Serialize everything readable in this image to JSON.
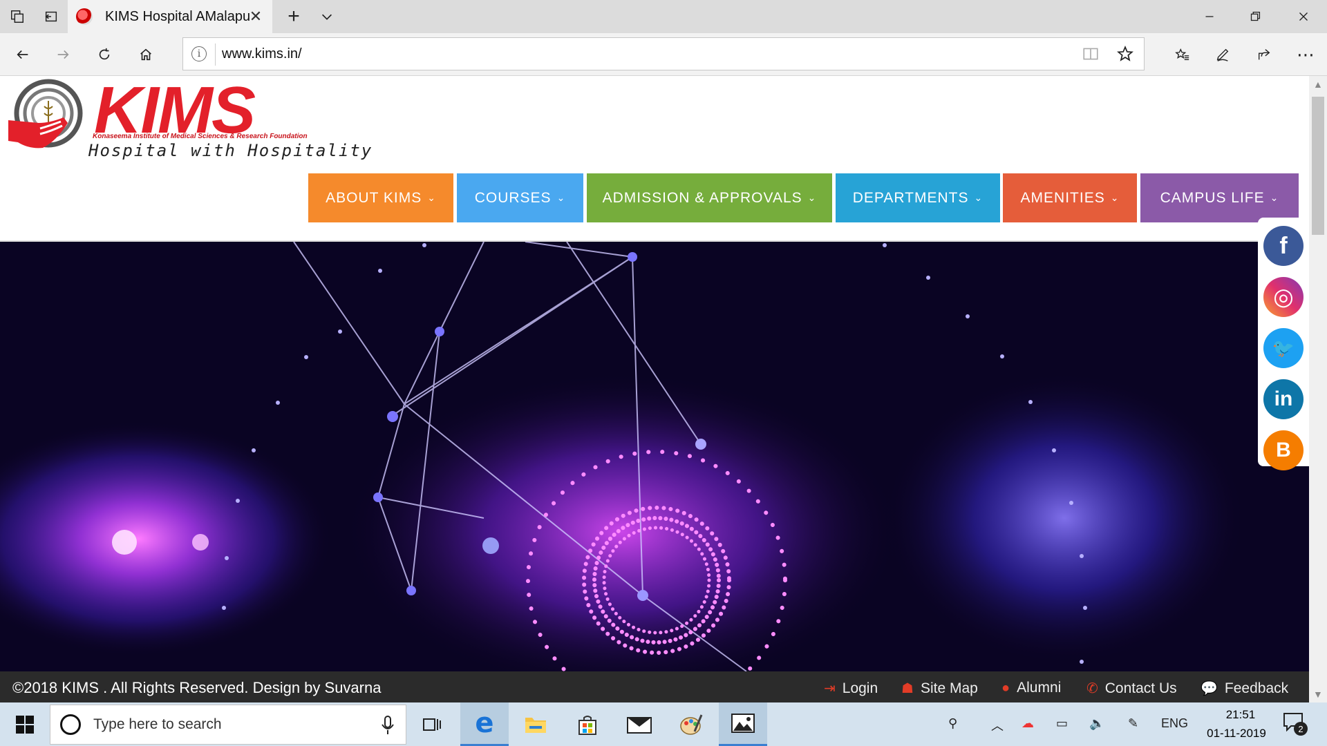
{
  "browser": {
    "tab_title": "KIMS Hospital AMalapu",
    "url": "www.kims.in/",
    "info_icon": "i"
  },
  "site": {
    "logo_word": "KIMS",
    "logo_fullname": "Konaseema Institute of Medical Sciences & Research Foundation",
    "logo_tagline": "Hospital with Hospitality",
    "nav": [
      {
        "label": "ABOUT KIMS",
        "color": "#f58a2c"
      },
      {
        "label": "COURSES",
        "color": "#4aa8f0"
      },
      {
        "label": "ADMISSION & APPROVALS",
        "color": "#76ad3c"
      },
      {
        "label": "DEPARTMENTS",
        "color": "#27a3d6"
      },
      {
        "label": "AMENITIES",
        "color": "#e55d3a"
      },
      {
        "label": "CAMPUS LIFE",
        "color": "#8b5aa8"
      }
    ],
    "social": [
      {
        "name": "facebook-icon",
        "glyph": "f",
        "color": "#3b5998"
      },
      {
        "name": "instagram-icon",
        "glyph": "◎",
        "color": "#d6249f"
      },
      {
        "name": "twitter-icon",
        "glyph": "🐦",
        "color": "#1da1f2"
      },
      {
        "name": "linkedin-icon",
        "glyph": "in",
        "color": "#0e76a8"
      },
      {
        "name": "blogger-icon",
        "glyph": "B",
        "color": "#f57d00"
      }
    ],
    "footer": {
      "copyright": "©2018 KIMS . All Rights Reserved. Design by Suvarna",
      "links": [
        "Login",
        "Site Map",
        "Alumni",
        "Contact Us",
        "Feedback"
      ]
    }
  },
  "taskbar": {
    "search_placeholder": "Type here to search",
    "language": "ENG",
    "time": "21:51",
    "date": "01-11-2019",
    "notification_count": "2"
  }
}
